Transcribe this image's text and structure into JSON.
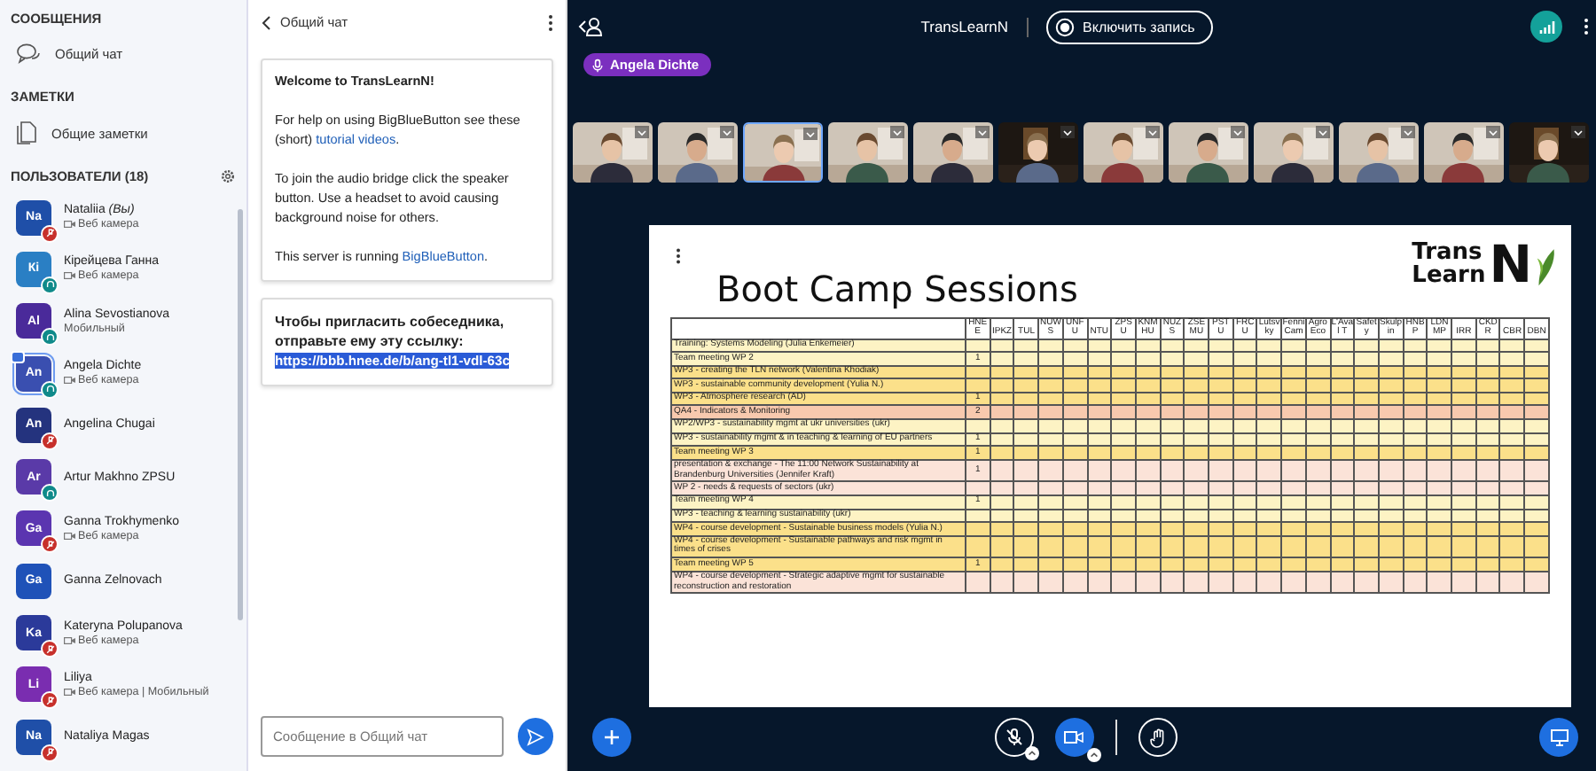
{
  "sidebar": {
    "messages_heading": "СООБЩЕНИЯ",
    "messages": [
      {
        "label": "Общий чат",
        "selected": false
      }
    ],
    "notes_heading": "ЗАМЕТКИ",
    "notes": [
      {
        "label": "Общие заметки"
      }
    ],
    "users_heading": "ПОЛЬЗОВАТЕЛИ (18)",
    "users": [
      {
        "initials": "Na",
        "name": "Nataliia *(Вы)*",
        "status": "Веб камера",
        "webcam": true,
        "color": "#1f4fa8",
        "in_audio": true,
        "muted": true,
        "presenter": false
      },
      {
        "initials": "Кі",
        "name": "Кірейцева Ганна",
        "status": "Веб камера",
        "webcam": true,
        "color": "#2a7fc4",
        "in_audio": true,
        "muted": false,
        "presenter": false
      },
      {
        "initials": "Al",
        "name": "Alina Sevostianova",
        "status": "Мобильный",
        "webcam": false,
        "color": "#4a2a9a",
        "in_audio": true,
        "muted": false,
        "presenter": false
      },
      {
        "initials": "An",
        "name": "Angela Dichte",
        "status": "Веб камера",
        "webcam": true,
        "color": "#3a4fb0",
        "in_audio": true,
        "muted": false,
        "presenter": true
      },
      {
        "initials": "An",
        "name": "Angelina Chugai",
        "color": "#24337e",
        "in_audio": true,
        "muted": true,
        "presenter": false
      },
      {
        "initials": "Ar",
        "name": "Artur Makhno ZPSU",
        "color": "#5a3aa8",
        "in_audio": true,
        "muted": false,
        "presenter": false
      },
      {
        "initials": "Ga",
        "name": "Ganna Trokhymenko",
        "status": "Веб камера",
        "webcam": true,
        "color": "#5b35b0",
        "in_audio": true,
        "muted": true,
        "presenter": false
      },
      {
        "initials": "Ga",
        "name": "Ganna Zelnovach",
        "color": "#1f52b8",
        "in_audio": false,
        "presenter": false
      },
      {
        "initials": "Ka",
        "name": "Kateryna Polupanova",
        "status": "Веб камера",
        "webcam": true,
        "color": "#2b3a9a",
        "in_audio": true,
        "muted": true,
        "presenter": false
      },
      {
        "initials": "Li",
        "name": "Liliya",
        "status": "Веб камера | Мобильный",
        "webcam": true,
        "color": "#7a2db0",
        "in_audio": true,
        "muted": true,
        "presenter": false
      },
      {
        "initials": "Na",
        "name": "Nataliya Magas",
        "color": "#1f4fa8",
        "in_audio": true,
        "muted": true,
        "presenter": false
      }
    ]
  },
  "chat": {
    "title": "Общий чат",
    "welcome": [
      {
        "kind": "bold",
        "text": "Welcome to TransLearnN!"
      },
      {
        "kind": "link",
        "before": "For help on using BigBlueButton see these (short) ",
        "link": "tutorial videos",
        "after": "."
      },
      {
        "kind": "plain",
        "text": "To join the audio bridge click the speaker button. Use a headset to avoid causing background noise for others."
      },
      {
        "kind": "link",
        "before": "This server is running ",
        "link": "BigBlueButton",
        "after": "."
      }
    ],
    "invite_text": "Чтобы пригласить собеседника, отправьте ему эту ссылку:",
    "invite_link": "https://bbb.hnee.de/b/ang-tl1-vdl-63c",
    "input": {
      "placeholder": "Сообщение в Общий чат"
    }
  },
  "topbar": {
    "title": "TransLearnN",
    "record_label": "Включить запись",
    "talker": "Angela Dichte"
  },
  "videos": [
    {
      "kind": "picture",
      "talking": false
    },
    {
      "kind": "picture",
      "talking": false
    },
    {
      "kind": "picture",
      "talking": true
    },
    {
      "kind": "picture",
      "talking": false
    },
    {
      "kind": "picture",
      "talking": false
    },
    {
      "kind": "picture",
      "talking": false
    },
    {
      "kind": "picture",
      "talking": false
    },
    {
      "kind": "picture",
      "talking": false
    },
    {
      "kind": "picture",
      "talking": false
    },
    {
      "kind": "picture",
      "talking": false
    },
    {
      "kind": "picture",
      "talking": false
    },
    {
      "kind": "picture",
      "talking": false
    }
  ],
  "slide": {
    "title": "Boot Camp Sessions",
    "logo_top": "Trans",
    "logo_bottom": "Learn",
    "logo_letter": "N",
    "columns": [
      "HNEE",
      "IPKZ",
      "TUL",
      "NUWS",
      "UNFU",
      "NTU",
      "ZPSU",
      "KNMHU",
      "NUZS",
      "ZSEMU",
      "PSTU",
      "FRCU",
      "Lutsvky",
      "FenniCam",
      "AgroEco",
      "L'Aval T",
      "Safety",
      "Skulpin",
      "HNBP",
      "LDNMP",
      "IRR",
      "CKDR",
      "CBR",
      "DBN"
    ],
    "rows": [
      {
        "label": "Training: Systems Modeling (Julia Enkemeier)",
        "color": "#fdf3c4"
      },
      {
        "label": "Team meeting WP 2",
        "value": "1",
        "color": "#fdf3c4"
      },
      {
        "label": "WP3 - creating the TLN network (Valentina Khodiak)",
        "color": "#fbe08a"
      },
      {
        "label": "WP3 - sustainable community development (Yulia N.)",
        "color": "#fbe08a"
      },
      {
        "label": "WP3 - Atmosphere research (AD)",
        "value": "1",
        "color": "#fbe08a"
      },
      {
        "label": "QA4 - Indicators & Monitoring",
        "value": "2",
        "color": "#f8c9ae"
      },
      {
        "label": "WP2/WP3 - sustainability mgmt at ukr universities (ukr)",
        "color": "#fdf3c4"
      },
      {
        "label": "WP3 - sustainability mgmt & in teaching & learning of EU partners",
        "value": "1",
        "color": "#fdf3c4"
      },
      {
        "label": "Team meeting WP 3",
        "value": "1",
        "color": "#fbe08a"
      },
      {
        "label": "presentation & exchange - The 11:00 Network Sustainability at Brandenburg Universities (Jennifer Kraft)",
        "value": "1",
        "color": "#fbe3d8"
      },
      {
        "label": "WP 2 - needs & requests of sectors (ukr)",
        "color": "#fbe3d8"
      },
      {
        "label": "Team meeting WP 4",
        "value": "1",
        "color": "#fdf3c4"
      },
      {
        "label": "WP3 - teaching & learning sustainability (ukr)",
        "color": "#fdf3c4"
      },
      {
        "label": "WP4 - course development - Sustainable business models (Yulia N.)",
        "color": "#fbe08a"
      },
      {
        "label": "WP4 - course development - Sustainable pathways and risk mgmt in times of crises",
        "color": "#fbe08a"
      },
      {
        "label": "Team meeting WP 5",
        "value": "1",
        "color": "#fbe08a"
      },
      {
        "label": "WP4 - course development - Strategic adaptive mgmt for sustainable reconstruction and restoration",
        "color": "#fbe3d8"
      }
    ]
  },
  "controls": {
    "mic_muted": true,
    "camera_on": true
  }
}
